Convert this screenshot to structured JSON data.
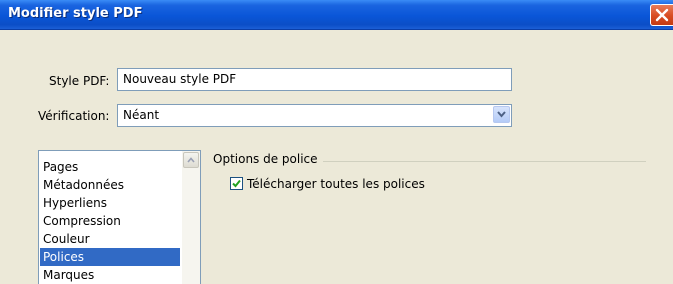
{
  "window": {
    "title": "Modifier style PDF",
    "close_icon": "close-icon"
  },
  "form": {
    "style_label": "Style PDF:",
    "style_value": "Nouveau style PDF",
    "verification_label": "Vérification:",
    "verification_value": "Néant",
    "dropdown_icon": "chevron-down-icon"
  },
  "sidebar": {
    "items": [
      {
        "label": "Pages",
        "selected": false
      },
      {
        "label": "Métadonnées",
        "selected": false
      },
      {
        "label": "Hyperliens",
        "selected": false
      },
      {
        "label": "Compression",
        "selected": false
      },
      {
        "label": "Couleur",
        "selected": false
      },
      {
        "label": "Polices",
        "selected": true
      },
      {
        "label": "Marques",
        "selected": false
      }
    ],
    "scroll_icon": "chevron-up-icon"
  },
  "font_options": {
    "group_title": "Options de police",
    "download_all_label": "Télécharger toutes les polices",
    "download_all_checked": true
  },
  "colors": {
    "titlebar": "#0a56d8",
    "dialog_bg": "#ece9d8",
    "selection": "#316ac5",
    "close_button": "#d84c22"
  }
}
